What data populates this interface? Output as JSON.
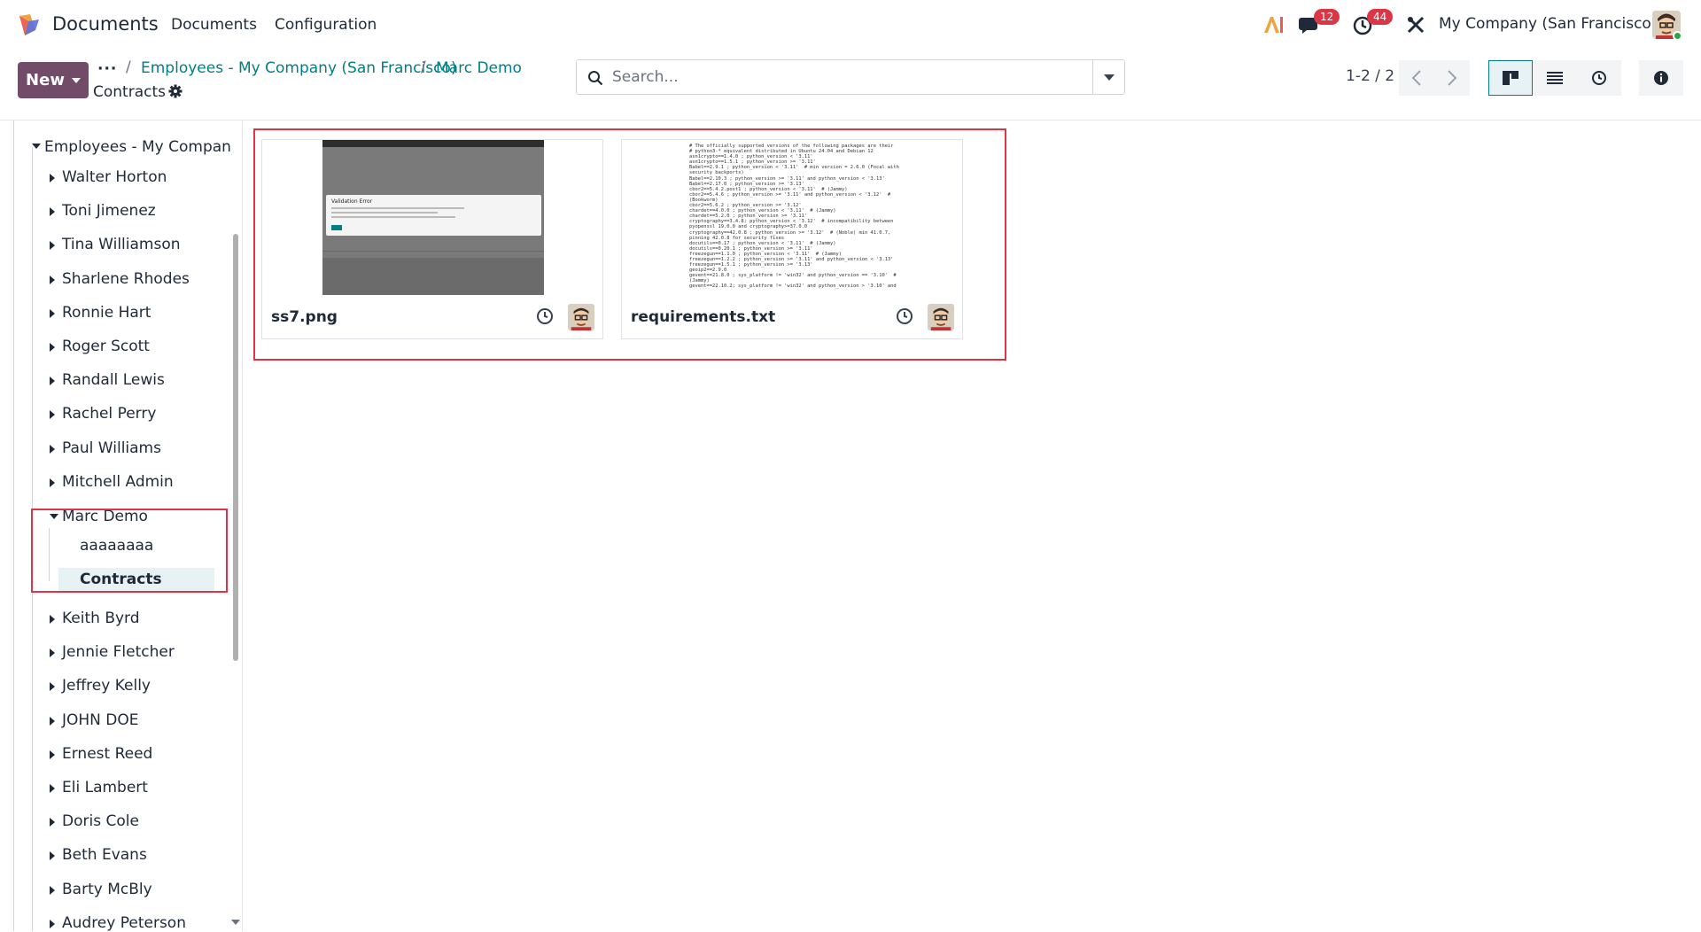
{
  "navbar": {
    "app_name": "Documents",
    "menu": [
      "Documents",
      "Configuration"
    ],
    "messages_count": "12",
    "activities_count": "44",
    "company": "My Company (San Francisco)"
  },
  "control_panel": {
    "new_label": "New",
    "breadcrumb": [
      "Employees - My Company (San Francisco)",
      "Marc Demo"
    ],
    "current": "Contracts",
    "search_placeholder": "Search...",
    "pager": "1-2 / 2"
  },
  "sidebar": {
    "root": "Employees - My Compan",
    "items": [
      "Walter Horton",
      "Toni Jimenez",
      "Tina Williamson",
      "Sharlene Rhodes",
      "Ronnie Hart",
      "Roger Scott",
      "Randall Lewis",
      "Rachel Perry",
      "Paul Williams",
      "Mitchell Admin"
    ],
    "expanded": {
      "name": "Marc Demo",
      "children": [
        "aaaaaaaa",
        "Contracts"
      ]
    },
    "items_after": [
      "Keith Byrd",
      "Jennie Fletcher",
      "Jeffrey Kelly",
      "JOHN DOE",
      "Ernest Reed",
      "Eli Lambert",
      "Doris Cole",
      "Beth Evans",
      "Barty McBly",
      "Audrey Peterson"
    ]
  },
  "documents": [
    {
      "name": "ss7.png",
      "thumbnail": "screenshot-image"
    },
    {
      "name": "requirements.txt",
      "thumbnail": "text-preview"
    }
  ],
  "preview_text": "# The officially supported versions of the following packages are their\n# python3-* equivalent distributed in Ubuntu 24.04 and Debian 12\nasn1crypto==1.4.0 ; python_version < '3.11'\nasn1crypto==1.5.1 ; python_version >= '3.11'\nBabel==2.9.1 ; python_version < '3.11'  # min version = 2.6.0 (Focal with\nsecurity backports)\nBabel==2.10.3 ; python_version >= '3.11' and python_version < '3.13'\nBabel==2.17.0 ; python_version >= '3.13'\ncbor2==5.4.2.post1 ; python_version < '3.11'  # (Jammy)\ncbor2==5.4.6 ; python_version >= '3.11' and python_version < '3.12'  #\n(Bookworm)\ncbor2==5.6.2 ; python_version >= '3.12'\nchardet==4.0.0 ; python_version < '3.11'  # (Jammy)\nchardet==5.2.0 ; python_version >= '3.11'\ncryptography==3.4.8; python_version < '3.12'  # incompatibility between\npyopenssl 19.0.0 and cryptography>=37.0.0\ncryptography==42.0.8 ; python_version >= '3.12'  # (Noble) min 41.0.7,\npinning 42.0.8 for security fixes\ndocutils==0.17 ; python_version < '3.11'  # (Jammy)\ndocutils==0.20.1 ; python_version >= '3.11'\nfreezegun==1.1.0 ; python_version < '3.11'  # (Jammy)\nfreezegun==1.2.2 ; python_version >= '3.11' and python_version < '3.13'\nfreezegun==1.5.1 ; python_version >= '3.13'\ngeoip2==2.9.0\ngevent==21.8.0 ; sys_platform != 'win32' and python_version == '3.10'  #\n(Jammy)\ngevent==22.10.2; sys_platform != 'win32' and python_version > '3.10' and",
  "screenshot_preview": {
    "dialog_title": "Validation Error"
  },
  "colors": {
    "brand": "#714b67",
    "link": "#017e84",
    "badge": "#dc3545",
    "highlight": "#dc3545"
  }
}
